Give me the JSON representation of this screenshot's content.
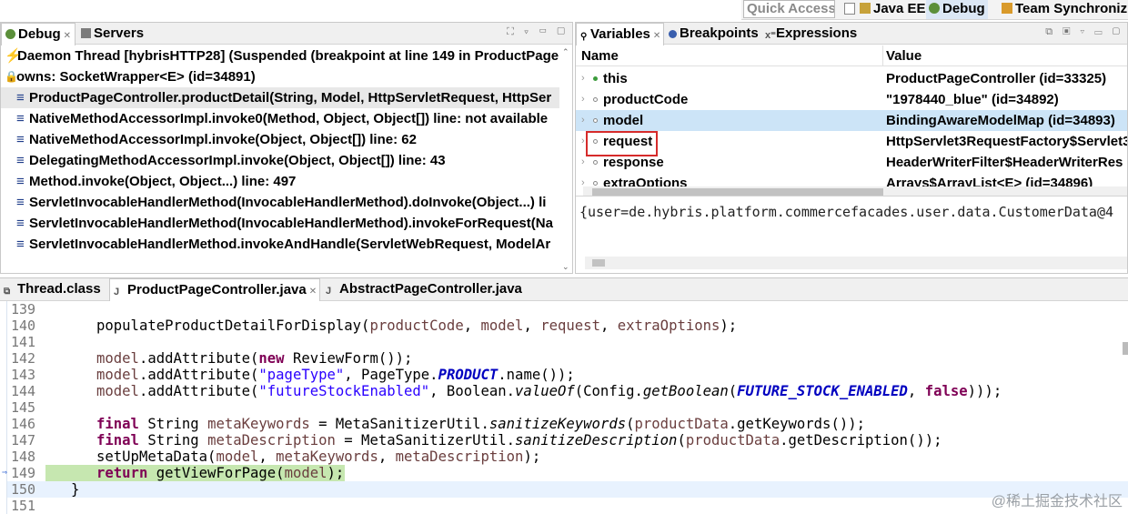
{
  "toolbar": {
    "quick_access": "Quick Access",
    "perspectives": [
      "Java EE",
      "Debug",
      "Team Synchronizing"
    ]
  },
  "debug_view": {
    "tabs": [
      "Debug",
      "Servers"
    ],
    "thread": "Daemon Thread [hybrisHTTP28] (Suspended (breakpoint at line 149 in ProductPage",
    "owns": "owns: SocketWrapper<E>  (id=34891)",
    "frames": [
      "ProductPageController.productDetail(String, Model, HttpServletRequest, HttpSer",
      "NativeMethodAccessorImpl.invoke0(Method, Object, Object[]) line: not available",
      "NativeMethodAccessorImpl.invoke(Object, Object[]) line: 62",
      "DelegatingMethodAccessorImpl.invoke(Object, Object[]) line: 43",
      "Method.invoke(Object, Object...) line: 497",
      "ServletInvocableHandlerMethod(InvocableHandlerMethod).doInvoke(Object...) li",
      "ServletInvocableHandlerMethod(InvocableHandlerMethod).invokeForRequest(Na",
      "ServletInvocableHandlerMethod.invokeAndHandle(ServletWebRequest, ModelAr"
    ]
  },
  "variables_view": {
    "tabs": [
      "Variables",
      "Breakpoints",
      "Expressions"
    ],
    "col_name": "Name",
    "col_value": "Value",
    "rows": [
      {
        "name": "this",
        "value": "ProductPageController  (id=33325)"
      },
      {
        "name": "productCode",
        "value": "\"1978440_blue\" (id=34892)"
      },
      {
        "name": "model",
        "value": "BindingAwareModelMap  (id=34893)"
      },
      {
        "name": "request",
        "value": "HttpServlet3RequestFactory$Servlet3"
      },
      {
        "name": "response",
        "value": "HeaderWriterFilter$HeaderWriterRes"
      },
      {
        "name": "extraOptions",
        "value": "Arrays$ArrayList<E>  (id=34896)"
      }
    ],
    "detail": "{user=de.hybris.platform.commercefacades.user.data.CustomerData@4"
  },
  "editor": {
    "tabs": [
      "Thread.class",
      "ProductPageController.java",
      "AbstractPageController.java"
    ],
    "line_numbers": [
      "139",
      "140",
      "141",
      "142",
      "143",
      "144",
      "145",
      "146",
      "147",
      "148",
      "149",
      "150",
      "151"
    ]
  },
  "watermark": "@稀土掘金技术社区",
  "colors": {
    "highlight_box": "#d62b2b",
    "current_line": "#c6e7b0",
    "selected_row": "#cce4f7"
  }
}
